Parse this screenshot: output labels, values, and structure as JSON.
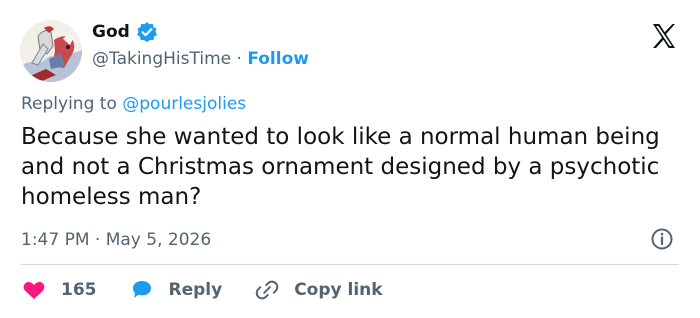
{
  "author": {
    "display_name": "God",
    "handle": "@TakingHisTime",
    "separator": "·",
    "follow_label": "Follow"
  },
  "reply_context": {
    "prefix": "Replying to",
    "mention": "@pourlesjolies"
  },
  "tweet": {
    "text": "Because she wanted to look like a normal human being and not a Christmas ornament designed by a psychotic homeless man?",
    "timestamp": "1:47 PM · May 5, 2026"
  },
  "actions": {
    "like_count": "165",
    "reply_label": "Reply",
    "copy_link_label": "Copy link"
  },
  "icons": {
    "avatar": "avatar-knight-icon",
    "verified": "verified-badge-icon",
    "brand": "x-logo-icon",
    "info": "info-icon",
    "like": "heart-icon",
    "reply": "speech-bubble-icon",
    "link": "link-icon"
  },
  "colors": {
    "accent": "#1d9bf0",
    "heart": "#f91880",
    "secondary_text": "#536471",
    "text": "#0f1419",
    "divider": "#cfd9de"
  }
}
